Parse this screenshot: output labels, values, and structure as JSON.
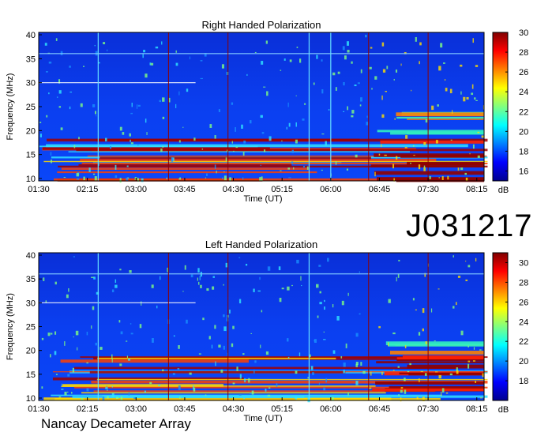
{
  "observation_id": "J031217",
  "instrument": "Nancay Decameter Array",
  "colors": {
    "background": "#ffffff",
    "colorscale": [
      "#00008f",
      "#0000ff",
      "#0080ff",
      "#00ffff",
      "#80ff80",
      "#ffff00",
      "#ff8000",
      "#ff0000",
      "#800000"
    ]
  },
  "chart_data": [
    {
      "type": "heatmap",
      "title": "Right Handed Polarization",
      "xlabel": "Time (UT)",
      "ylabel": "Frequency (MHz)",
      "x_ticks": [
        "01:30",
        "02:15",
        "03:00",
        "03:45",
        "04:30",
        "05:15",
        "06:00",
        "06:45",
        "07:30",
        "08:15"
      ],
      "y_ticks": [
        10,
        15,
        20,
        25,
        30,
        35,
        40
      ],
      "ylim": [
        9.5,
        40.5
      ],
      "colorbar": {
        "label": "dB",
        "ticks": [
          16,
          18,
          20,
          22,
          24,
          26,
          28,
          30
        ],
        "range": [
          15,
          30
        ]
      },
      "time_markers": [
        "03:30",
        "04:25",
        "06:35",
        "07:30"
      ],
      "interference_lines": [
        "02:25",
        "05:40",
        "06:00"
      ]
    },
    {
      "type": "heatmap",
      "title": "Left Handed Polarization",
      "xlabel": "Time (UT)",
      "ylabel": "Frequency (MHz)",
      "x_ticks": [
        "01:30",
        "02:15",
        "03:00",
        "03:45",
        "04:30",
        "05:15",
        "06:00",
        "06:45",
        "07:30",
        "08:15"
      ],
      "y_ticks": [
        10,
        15,
        20,
        25,
        30,
        35,
        40
      ],
      "ylim": [
        9.5,
        40.5
      ],
      "colorbar": {
        "label": "dB",
        "ticks": [
          18,
          20,
          22,
          24,
          26,
          28,
          30
        ],
        "range": [
          16,
          31
        ]
      },
      "time_markers": [
        "03:30",
        "04:25",
        "06:35",
        "07:30"
      ],
      "interference_lines": [
        "02:25",
        "05:40"
      ]
    }
  ]
}
